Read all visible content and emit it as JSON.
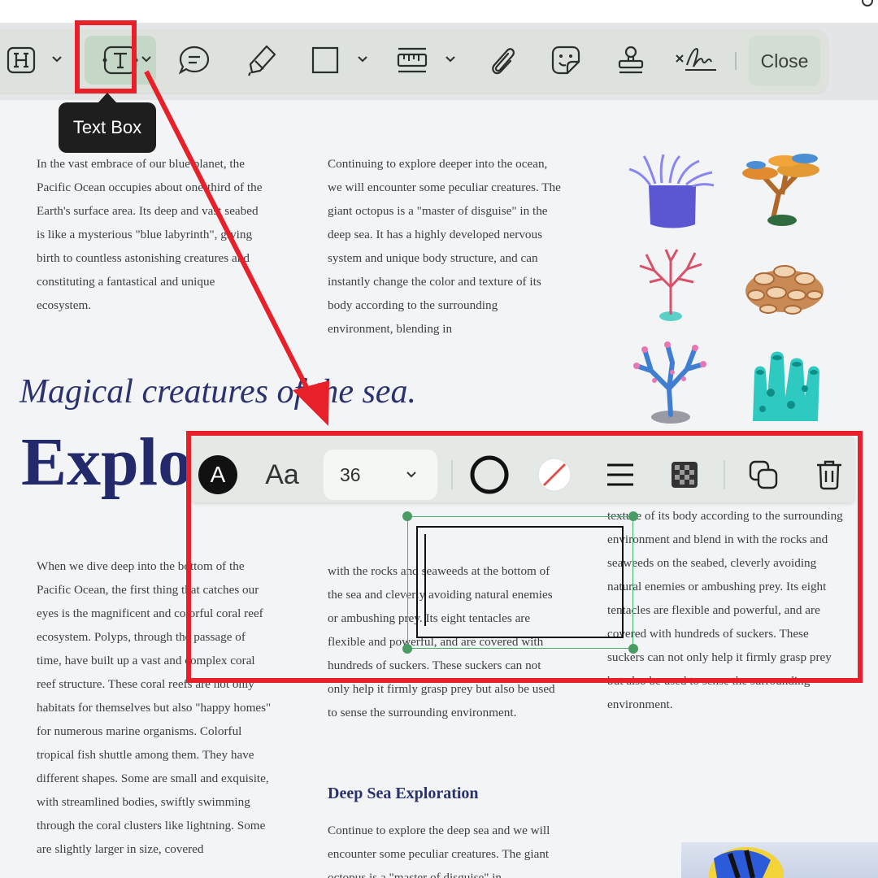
{
  "toolbar": {
    "items": [
      "heading-tool",
      "text-box-tool",
      "comment-tool",
      "highlighter-tool",
      "shape-tool",
      "measure-tool",
      "attachment-tool",
      "sticker-tool",
      "stamp-tool",
      "signature-tool"
    ],
    "close_label": "Close",
    "tooltip": "Text Box"
  },
  "document": {
    "para_1": "In the vast embrace of our blue planet, the Pacific Ocean occupies about one-third of the Earth's surface area. Its deep and vast seabed is like a mysterious \"blue labyrinth\", giving birth to countless astonishing creatures and constituting a fantastical and unique ecosystem.",
    "para_2": "Continuing to explore deeper into the ocean, we will encounter some peculiar creatures. The giant octopus is a \"master of disguise\" in the deep sea. It has a highly developed nervous system and unique body structure, and can instantly change the color and texture of its body according to the surrounding environment, blending in",
    "subtitle": "Magical creatures of the sea.",
    "big_title": "Explo",
    "para_3": "When we dive deep into the bottom of the Pacific Ocean, the first thing that catches our eyes is the magnificent and colorful coral reef ecosystem. Polyps, through the passage of time, have built up a vast and complex coral reef structure. These coral reefs are not only habitats for themselves but also \"happy homes\" for numerous marine organisms. Colorful tropical fish shuttle among them. They have different shapes. Some are small and exquisite, with streamlined bodies, swiftly swimming through the coral clusters like lightning. Some are slightly larger in size, covered",
    "para_4": "with the rocks and seaweeds at the bottom of the sea and cleverly avoiding natural enemies or ambushing prey. Its eight tentacles are flexible and powerful, and are covered with hundreds of suckers. These suckers can not only help it firmly grasp prey but also be used to sense the surrounding environment.",
    "para_5": "texture of its body according to the surrounding environment and blend in with the rocks and seaweeds on the seabed, cleverly avoiding natural enemies or ambushing prey. Its eight tentacles are flexible and powerful, and are covered with hundreds of suckers. These suckers can not only help it firmly grasp prey but also be used to sense the surrounding environment.",
    "section_heading": "Deep Sea Exploration",
    "para_6": "Continue to explore the deep sea and we will encounter some peculiar creatures. The giant octopus is a \"master of disguise\" in"
  },
  "format_toolbar": {
    "text_color_glyph": "A",
    "font_glyph": "Aa",
    "font_size": "36",
    "border_color": "#111111",
    "fill_color": "none",
    "accent": "#4caf6e"
  },
  "annotation": {
    "color": "#e8202a"
  }
}
